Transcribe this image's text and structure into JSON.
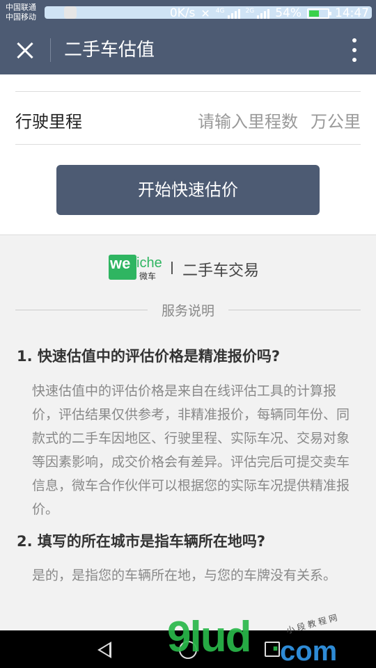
{
  "status_bar": {
    "carrier1": "中国联通",
    "carrier2": "中国移动",
    "speed": "0K/s",
    "net1": "4G",
    "net2": "2G",
    "battery": "54%",
    "battery_level": 0.54,
    "time": "14:47"
  },
  "titlebar": {
    "title": "二手车估值"
  },
  "form": {
    "mileage_label": "行驶里程",
    "mileage_placeholder": "请输入里程数",
    "mileage_unit": "万公里",
    "start_button": "开始快速估价"
  },
  "brand": {
    "logo_we": "we",
    "logo_che": "iche",
    "logo_sub": "微车",
    "text": "二手车交易"
  },
  "service": {
    "title": "服务说明",
    "items": [
      {
        "q": "1. 快速估值中的评估价格是精准报价吗?",
        "a": "快速估值中的评估价格是来自在线评估工具的计算报价，评估结果仅供参考，非精准报价，每辆同年份、同款式的二手车因地区、行驶里程、实际车况、交易对象等因素影响，成交价格会有差异。评估完后可提交卖车信息，微车合作伙伴可以根据您的实际车况提供精准报价。"
      },
      {
        "q": "2. 填写的所在城市是指车辆所在地吗?",
        "a": "是的，是指您的车辆所在地，与您的车牌没有关系。"
      }
    ]
  },
  "watermark": {
    "main": "9lud",
    "com": "com",
    "small": "小 段 教 程 网"
  },
  "colors": {
    "header_bg": "#4d5b73",
    "brand_green": "#2fb561"
  }
}
